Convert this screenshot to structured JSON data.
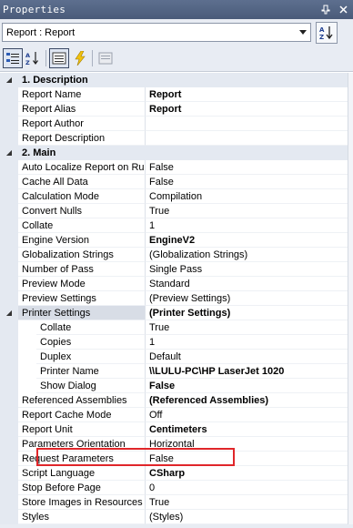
{
  "window": {
    "title": "Properties",
    "pin_icon": "pin-icon",
    "close_icon": "close-icon"
  },
  "object_selector": {
    "value": "Report : Report"
  },
  "toolbar": {
    "buttons": [
      "categorized-icon",
      "alphabetical-icon",
      "properties-icon",
      "events-icon",
      "property-pages-icon"
    ]
  },
  "categories": [
    {
      "label": "1. Description",
      "rows": [
        {
          "name": "Report Name",
          "value": "Report"
        },
        {
          "name": "Report Alias",
          "value": "Report"
        },
        {
          "name": "Report Author",
          "value": ""
        },
        {
          "name": "Report Description",
          "value": ""
        }
      ]
    },
    {
      "label": "2. Main",
      "rows": [
        {
          "name": "Auto Localize Report on Run",
          "value": "False"
        },
        {
          "name": "Cache All Data",
          "value": "False"
        },
        {
          "name": "Calculation Mode",
          "value": "Compilation"
        },
        {
          "name": "Convert Nulls",
          "value": "True"
        },
        {
          "name": "Collate",
          "value": "1"
        },
        {
          "name": "Engine Version",
          "value": "EngineV2"
        },
        {
          "name": "Globalization Strings",
          "value": "(Globalization Strings)"
        },
        {
          "name": "Number of Pass",
          "value": "Single Pass"
        },
        {
          "name": "Preview Mode",
          "value": "Standard"
        },
        {
          "name": "Preview Settings",
          "value": "(Preview Settings)"
        },
        {
          "name": "Printer Settings",
          "value": "(Printer Settings)"
        },
        {
          "name": "Collate",
          "value": "True"
        },
        {
          "name": "Copies",
          "value": "1"
        },
        {
          "name": "Duplex",
          "value": "Default"
        },
        {
          "name": "Printer Name",
          "value": "\\\\LULU-PC\\HP LaserJet 1020"
        },
        {
          "name": "Show Dialog",
          "value": "False"
        },
        {
          "name": "Referenced Assemblies",
          "value": "(Referenced Assemblies)"
        },
        {
          "name": "Report Cache Mode",
          "value": "Off"
        },
        {
          "name": "Report Unit",
          "value": "Centimeters"
        },
        {
          "name": "Parameters Orientation",
          "value": "Horizontal"
        },
        {
          "name": "Request Parameters",
          "value": "False"
        },
        {
          "name": "Script Language",
          "value": "CSharp"
        },
        {
          "name": "Stop Before Page",
          "value": "0"
        },
        {
          "name": "Store Images in Resources",
          "value": "True"
        },
        {
          "name": "Styles",
          "value": "(Styles)"
        }
      ]
    }
  ],
  "highlight_color": "#e0262a"
}
